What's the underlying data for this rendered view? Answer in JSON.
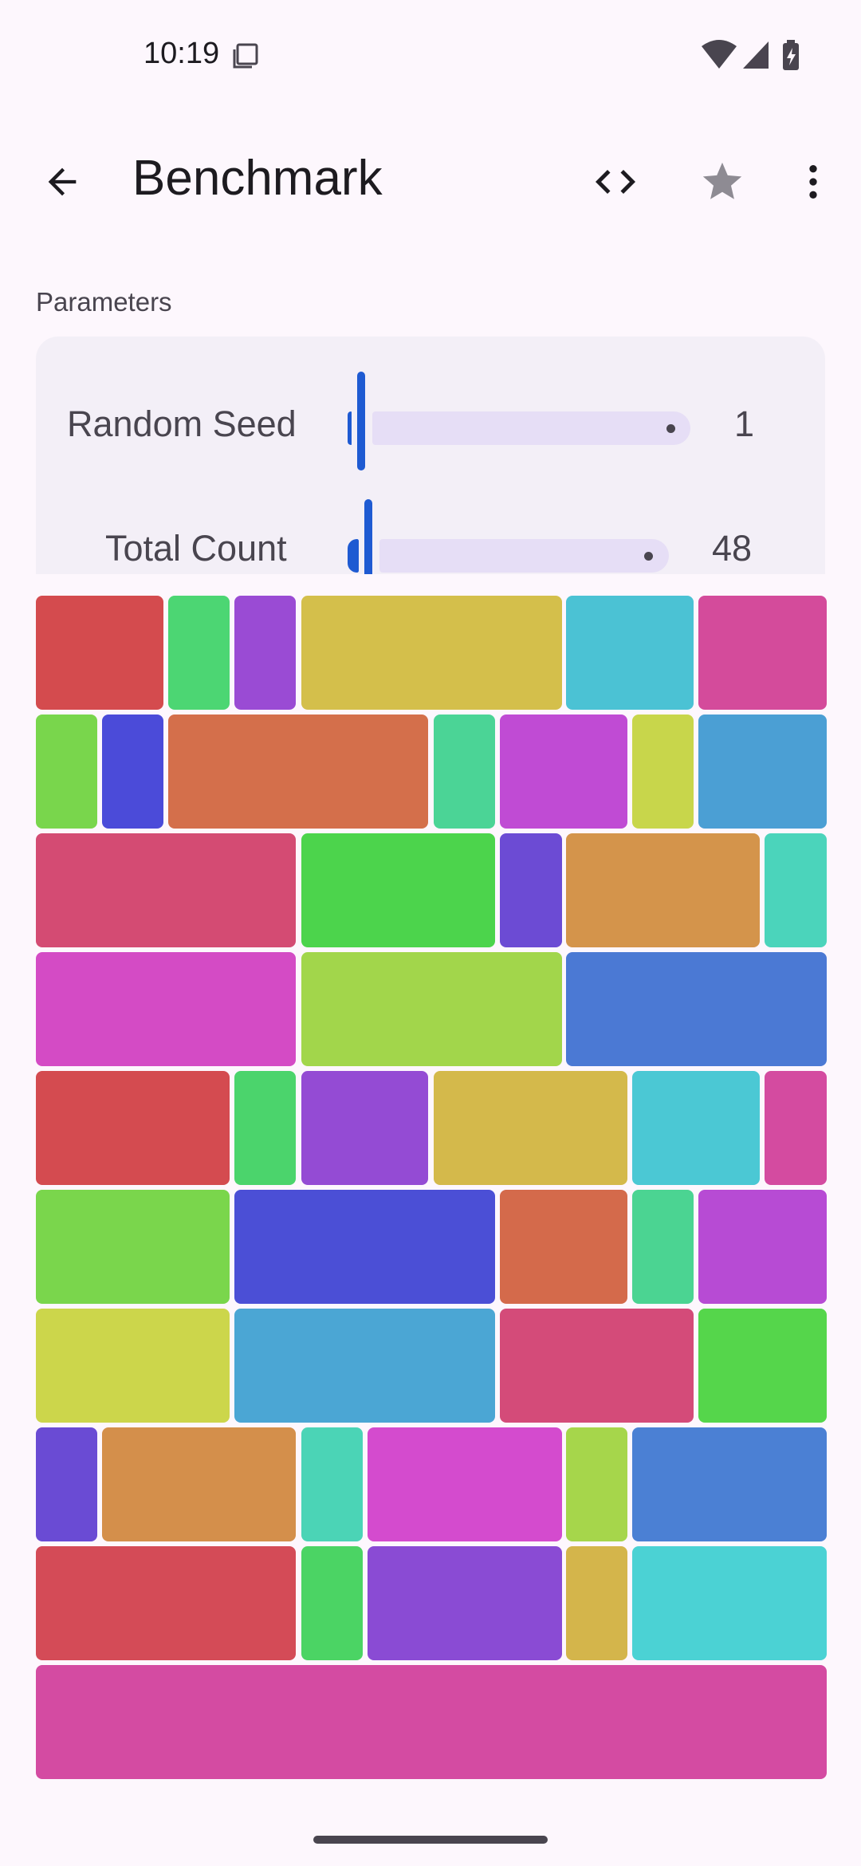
{
  "status_bar": {
    "time": "10:19"
  },
  "app_bar": {
    "title": "Benchmark",
    "back_icon": "arrow-back-icon",
    "code_icon": "code-icon",
    "star_icon": "star-icon",
    "more_icon": "more-vert-icon"
  },
  "parameters": {
    "section_label": "Parameters",
    "random_seed": {
      "label": "Random Seed",
      "value": "1",
      "fraction": 0.0
    },
    "total_count": {
      "label": "Total Count",
      "value": "48",
      "fraction": 0.02
    }
  },
  "tiles": [
    {
      "color": "#d44b4e"
    },
    {
      "color": "#4cd673"
    },
    {
      "color": "#9a4bd4"
    },
    {
      "color": "#d4bf4b"
    },
    {
      "color": "#4bc2d4"
    },
    {
      "color": "#d44b9b"
    },
    {
      "color": "#79d64c"
    },
    {
      "color": "#4b4bd9"
    },
    {
      "color": "#d46f4b"
    },
    {
      "color": "#4bd496"
    },
    {
      "color": "#c04bd4"
    },
    {
      "color": "#c8d64b"
    },
    {
      "color": "#4b9fd4"
    },
    {
      "color": "#d44b73"
    },
    {
      "color": "#4cd44c"
    },
    {
      "color": "#6c4bd4"
    },
    {
      "color": "#d4944b"
    },
    {
      "color": "#4bd4bb"
    },
    {
      "color": "#d44bc5"
    },
    {
      "color": "#a2d64b"
    },
    {
      "color": "#4b79d4"
    },
    {
      "color": "#d44b50"
    },
    {
      "color": "#4bd46c"
    },
    {
      "color": "#944bd4"
    },
    {
      "color": "#d4b94b"
    },
    {
      "color": "#4bc8d4"
    },
    {
      "color": "#d44ba0"
    },
    {
      "color": "#7ad64c"
    },
    {
      "color": "#4b4fd6"
    },
    {
      "color": "#d46a4b"
    },
    {
      "color": "#4bd492"
    },
    {
      "color": "#b74bd4"
    },
    {
      "color": "#ccd64b"
    },
    {
      "color": "#4ba6d4"
    },
    {
      "color": "#d44b79"
    },
    {
      "color": "#55d64b"
    },
    {
      "color": "#6a4bd4"
    },
    {
      "color": "#d48f4b"
    },
    {
      "color": "#4bd4b6"
    },
    {
      "color": "#d44bce"
    },
    {
      "color": "#a6d64b"
    },
    {
      "color": "#4b80d4"
    },
    {
      "color": "#d44b57"
    },
    {
      "color": "#4bd464"
    },
    {
      "color": "#8a4bd4"
    },
    {
      "color": "#d4b54b"
    },
    {
      "color": "#4bd2d4"
    },
    {
      "color": "#d44ba2"
    }
  ]
}
